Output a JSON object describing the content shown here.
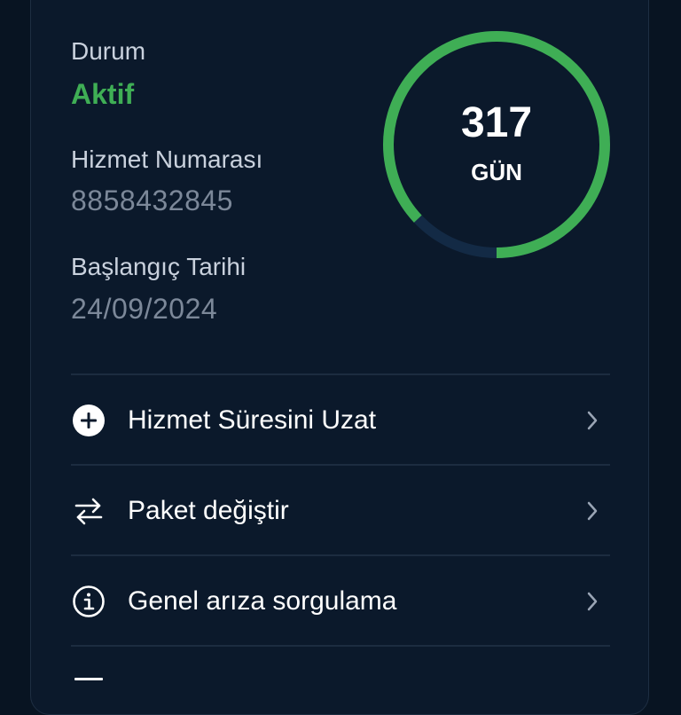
{
  "service": {
    "status_label": "Durum",
    "status_value": "Aktif",
    "number_label": "Hizmet Numarası",
    "number_value": "8858432845",
    "start_label": "Başlangıç Tarihi",
    "start_value": "24/09/2024"
  },
  "days_ring": {
    "days": "317",
    "unit": "GÜN",
    "progress_fraction": 0.87,
    "progress_color": "#3fae55",
    "track_color": "#132a45"
  },
  "menu": {
    "items": [
      {
        "label": "Hizmet Süresini Uzat",
        "icon": "plus-circle-icon"
      },
      {
        "label": "Paket değiştir",
        "icon": "swap-arrows-icon"
      },
      {
        "label": "Genel arıza sorgulama",
        "icon": "info-circle-icon"
      }
    ]
  },
  "colors": {
    "background": "#081422",
    "card": "#0b192b",
    "accent_green": "#3fae55",
    "muted_text": "#7c8899"
  }
}
